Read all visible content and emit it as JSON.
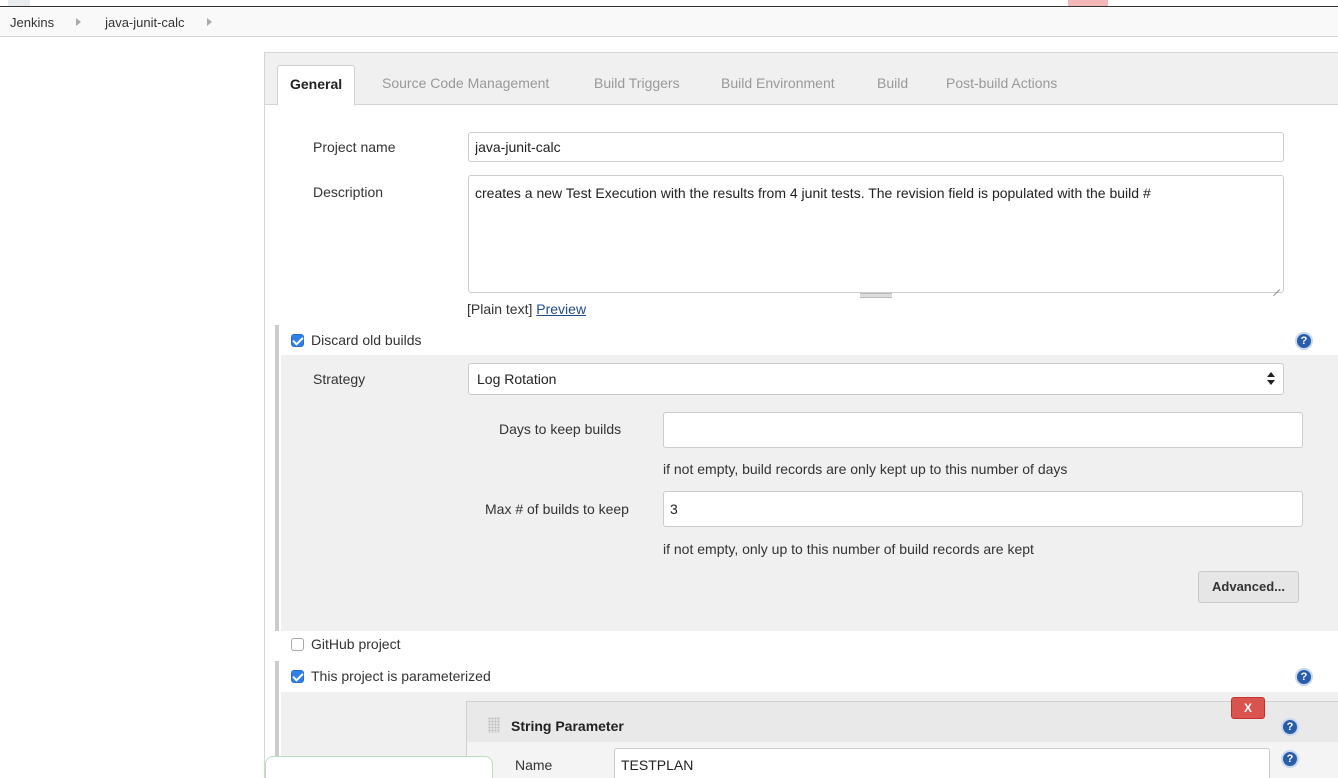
{
  "breadcrumb": {
    "items": [
      "Jenkins",
      "java-junit-calc"
    ]
  },
  "tabs": [
    {
      "label": "General",
      "active": true
    },
    {
      "label": "Source Code Management",
      "active": false
    },
    {
      "label": "Build Triggers",
      "active": false
    },
    {
      "label": "Build Environment",
      "active": false
    },
    {
      "label": "Build",
      "active": false
    },
    {
      "label": "Post-build Actions",
      "active": false
    }
  ],
  "general": {
    "project_name_label": "Project name",
    "project_name_value": "java-junit-calc",
    "description_label": "Description",
    "description_value": "creates a new Test Execution with the results from 4 junit tests. The revision field is populated with the build #",
    "plain_text_label": "[Plain text]",
    "preview_link": "Preview"
  },
  "discard_old_builds": {
    "label": "Discard old builds",
    "checked": true,
    "strategy_label": "Strategy",
    "strategy_value": "Log Rotation",
    "days_label": "Days to keep builds",
    "days_value": "",
    "days_hint": "if not empty, build records are only kept up to this number of days",
    "max_label": "Max # of builds to keep",
    "max_value": "3",
    "max_hint": "if not empty, only up to this number of build records are kept",
    "advanced_button": "Advanced..."
  },
  "github_project": {
    "label": "GitHub project",
    "checked": false
  },
  "parameterized": {
    "label": "This project is parameterized",
    "checked": true,
    "parameter": {
      "title": "String Parameter",
      "delete_button": "X",
      "name_label": "Name",
      "name_value": "TESTPLAN"
    }
  },
  "help_icon_glyph": "?",
  "colors": {
    "checkbox_checked": "#2f7fe8",
    "help_icon": "#2a5da8",
    "delete_button": "#d9534f",
    "link": "#204a87"
  }
}
